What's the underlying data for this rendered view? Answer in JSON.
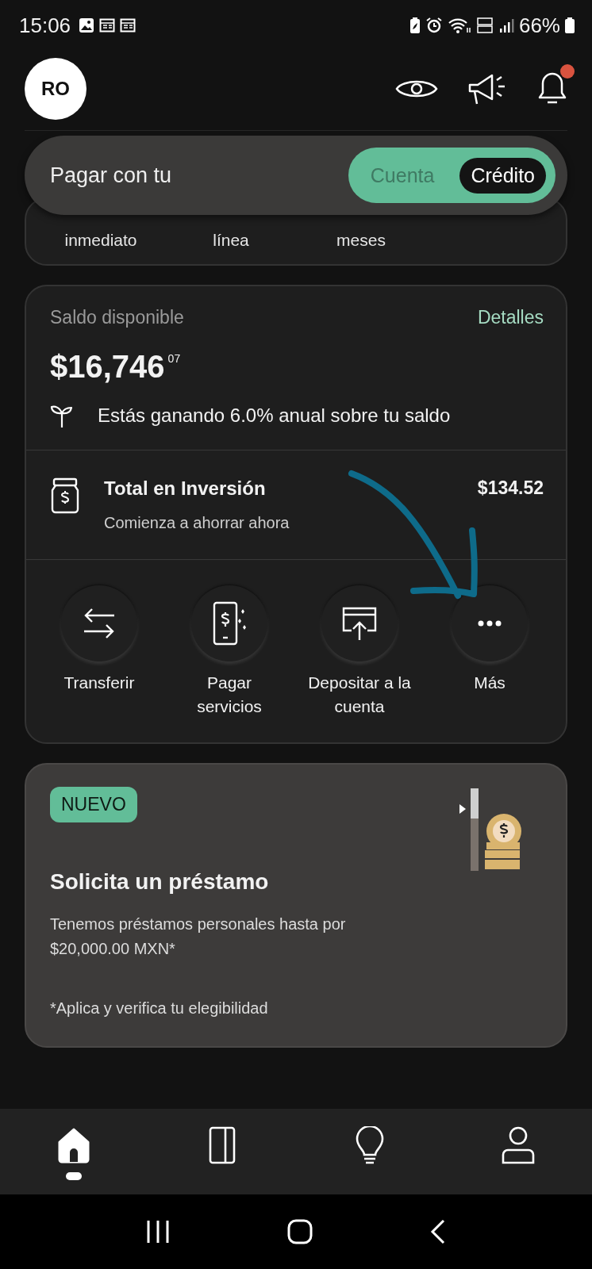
{
  "status_bar": {
    "time": "15:06",
    "battery": "66%"
  },
  "header": {
    "avatar": "RO",
    "has_notification": true
  },
  "pay_toggle": {
    "label": "Pagar con tu",
    "options": [
      {
        "label": "Cuenta",
        "selected": false
      },
      {
        "label": "Crédito",
        "selected": true
      }
    ]
  },
  "shortcuts": [
    {
      "label": "inmediato"
    },
    {
      "label": "línea"
    },
    {
      "label": "meses"
    }
  ],
  "balance": {
    "title": "Saldo disponible",
    "link": "Detalles",
    "amount": "$16,746",
    "cents": "07",
    "note": "Estás ganando 6.0% anual sobre tu saldo"
  },
  "investment": {
    "title": "Total en Inversión",
    "subtitle": "Comienza a ahorrar ahora",
    "amount": "$134.52"
  },
  "actions": [
    {
      "kind": "transfer",
      "label": "Transferir"
    },
    {
      "kind": "bills",
      "label": "Pagar servicios"
    },
    {
      "kind": "deposit",
      "label": "Depositar a la cuenta"
    },
    {
      "kind": "more",
      "label": "Más"
    }
  ],
  "promo": {
    "badge": "NUEVO",
    "title": "Solicita un préstamo",
    "description": "Tenemos préstamos personales hasta por $20,000.00 MXN*",
    "footnote": "*Aplica y verifica tu elegibilidad"
  },
  "bottom_nav": [
    {
      "kind": "home",
      "selected": true
    },
    {
      "kind": "card",
      "selected": false
    },
    {
      "kind": "tips",
      "selected": false
    },
    {
      "kind": "profile",
      "selected": false
    }
  ]
}
